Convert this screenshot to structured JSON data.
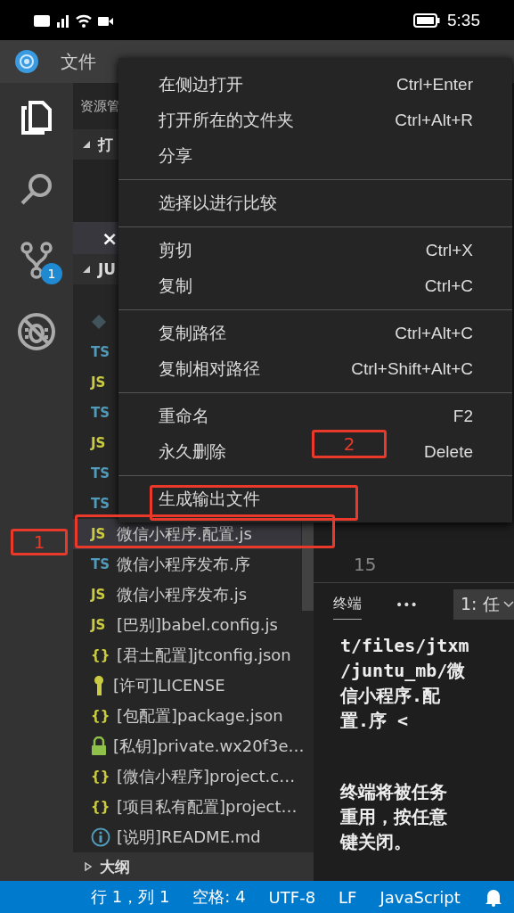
{
  "phone_status": {
    "time": "5:35"
  },
  "menubar": {
    "items": [
      {
        "label": "文件"
      }
    ]
  },
  "activity_bar": [
    {
      "kind": "files",
      "selected": true
    },
    {
      "kind": "search",
      "selected": false
    },
    {
      "kind": "source-control",
      "selected": false,
      "badge": "1"
    },
    {
      "kind": "debug",
      "selected": false
    }
  ],
  "sidebar": {
    "title": "资源管",
    "open_editors": {
      "label": "打",
      "expanded": true,
      "close": "×"
    },
    "folder": {
      "label": "JU",
      "expanded": true
    },
    "files": [
      {
        "kind": "git"
      },
      {
        "kind": "ts",
        "badge": "TS",
        "selected": false
      },
      {
        "kind": "js",
        "badge": "JS",
        "selected": false
      },
      {
        "kind": "ts",
        "badge": "TS",
        "selected": false
      },
      {
        "kind": "js",
        "badge": "JS",
        "selected": false
      },
      {
        "kind": "ts",
        "badge": "TS",
        "selected": false
      },
      {
        "kind": "ts",
        "badge": "TS",
        "selected": false
      },
      {
        "kind": "js",
        "badge": "JS",
        "name": "微信小程序.配置.js",
        "selected": true
      },
      {
        "kind": "ts",
        "badge": "TS",
        "name": "微信小程序发布.序",
        "selected": false
      },
      {
        "kind": "js",
        "badge": "JS",
        "name": "微信小程序发布.js",
        "selected": false
      },
      {
        "kind": "js",
        "badge": "JS",
        "name": "[巴别]babel.config.js",
        "selected": false
      },
      {
        "kind": "json",
        "badge": "{}",
        "name": "[君土配置]jtconfig.json",
        "selected": false
      },
      {
        "kind": "license",
        "name": "[许可]LICENSE",
        "selected": false
      },
      {
        "kind": "json",
        "badge": "{}",
        "name": "[包配置]package.json",
        "selected": false
      },
      {
        "kind": "lock",
        "name": "[私钥]private.wx20f3e…",
        "selected": false
      },
      {
        "kind": "json",
        "badge": "{}",
        "name": "[微信小程序]project.c…",
        "selected": false
      },
      {
        "kind": "json",
        "badge": "{}",
        "name": "[项目私有配置]project…",
        "selected": false
      },
      {
        "kind": "info",
        "name": "[说明]README.md",
        "selected": false
      }
    ],
    "outline": {
      "label": "大纲",
      "expanded": false
    }
  },
  "editor": {
    "line_number": "15"
  },
  "terminal": {
    "tab": "终端",
    "more": "•••",
    "dropdown": "1: 任",
    "paragraphs": [
      [
        "t/files/jtxm",
        "/juntu_mb/微",
        "信小程序.配",
        "置.序 <"
      ],
      [
        "终端将被任务",
        "重用，按任意",
        "键关闭。"
      ]
    ]
  },
  "status_bar": {
    "items": [
      "行 1，列 1",
      "空格: 4",
      "UTF-8",
      "LF",
      "JavaScript"
    ]
  },
  "context_menu": {
    "groups": [
      {
        "items": [
          {
            "label": "在侧边打开",
            "shortcut": "Ctrl+Enter"
          },
          {
            "label": "打开所在的文件夹",
            "shortcut": "Ctrl+Alt+R"
          },
          {
            "label": "分享"
          }
        ]
      },
      {
        "items": [
          {
            "label": "选择以进行比较"
          }
        ]
      },
      {
        "items": [
          {
            "label": "剪切",
            "shortcut": "Ctrl+X"
          },
          {
            "label": "复制",
            "shortcut": "Ctrl+C"
          }
        ]
      },
      {
        "items": [
          {
            "label": "复制路径",
            "shortcut": "Ctrl+Alt+C"
          },
          {
            "label": "复制相对路径",
            "shortcut": "Ctrl+Shift+Alt+C"
          }
        ]
      },
      {
        "items": [
          {
            "label": "重命名",
            "shortcut": "F2"
          },
          {
            "label": "永久删除",
            "shortcut": "Delete"
          }
        ]
      },
      {
        "items": [
          {
            "label": "生成输出文件"
          }
        ]
      }
    ]
  },
  "annotations": [
    {
      "kind": "label",
      "label": "1"
    },
    {
      "kind": "frame"
    },
    {
      "kind": "frame"
    },
    {
      "kind": "label",
      "label": "2"
    }
  ]
}
